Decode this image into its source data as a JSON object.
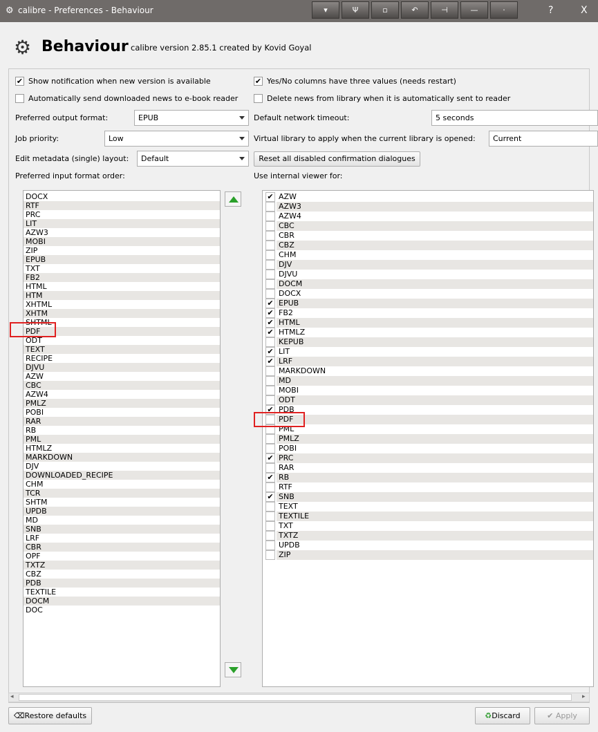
{
  "window": {
    "title": "calibre - Preferences - Behaviour",
    "help": "?",
    "close": "X"
  },
  "header": {
    "title": "Behaviour",
    "subtitle": "calibre version 2.85.1 created by Kovid Goyal"
  },
  "options": {
    "show_notification": {
      "label": "Show notification when new version is available",
      "checked": true
    },
    "yes_no": {
      "label": "Yes/No columns have three values (needs restart)",
      "checked": true
    },
    "auto_send_news": {
      "label": "Automatically send downloaded news to e-book reader",
      "checked": false
    },
    "delete_news": {
      "label": "Delete news from library when it is automatically sent to reader",
      "checked": false
    },
    "output_format": {
      "label": "Preferred output format:",
      "value": "EPUB"
    },
    "network_timeout": {
      "label": "Default network timeout:",
      "value": "5 seconds"
    },
    "job_priority": {
      "label": "Job priority:",
      "value": "Low"
    },
    "virtual_library": {
      "label": "Virtual library to apply when the current library is opened:",
      "value": "Current"
    },
    "edit_metadata_layout": {
      "label": "Edit metadata (single) layout:",
      "value": "Default"
    },
    "reset_dialogs": "Reset all disabled confirmation dialogues",
    "input_order_label": "Preferred input format order:",
    "viewer_label": "Use internal viewer for:"
  },
  "input_formats": [
    "DOCX",
    "RTF",
    "PRC",
    "LIT",
    "AZW3",
    "MOBI",
    "ZIP",
    "EPUB",
    "TXT",
    "FB2",
    "HTML",
    "HTM",
    "XHTML",
    "XHTM",
    "SHTML",
    "PDF",
    "ODT",
    "TEXT",
    "RECIPE",
    "DJVU",
    "AZW",
    "CBC",
    "AZW4",
    "PMLZ",
    "POBI",
    "RAR",
    "RB",
    "PML",
    "HTMLZ",
    "MARKDOWN",
    "DJV",
    "DOWNLOADED_RECIPE",
    "CHM",
    "TCR",
    "SHTM",
    "UPDB",
    "MD",
    "SNB",
    "LRF",
    "CBR",
    "OPF",
    "TXTZ",
    "CBZ",
    "PDB",
    "TEXTILE",
    "DOCM",
    "DOC"
  ],
  "viewer_formats": [
    {
      "name": "AZW",
      "checked": true
    },
    {
      "name": "AZW3",
      "checked": false
    },
    {
      "name": "AZW4",
      "checked": false
    },
    {
      "name": "CBC",
      "checked": false
    },
    {
      "name": "CBR",
      "checked": false
    },
    {
      "name": "CBZ",
      "checked": false
    },
    {
      "name": "CHM",
      "checked": false
    },
    {
      "name": "DJV",
      "checked": false
    },
    {
      "name": "DJVU",
      "checked": false
    },
    {
      "name": "DOCM",
      "checked": false
    },
    {
      "name": "DOCX",
      "checked": false
    },
    {
      "name": "EPUB",
      "checked": true
    },
    {
      "name": "FB2",
      "checked": true
    },
    {
      "name": "HTML",
      "checked": true
    },
    {
      "name": "HTMLZ",
      "checked": true
    },
    {
      "name": "KEPUB",
      "checked": false
    },
    {
      "name": "LIT",
      "checked": true
    },
    {
      "name": "LRF",
      "checked": true
    },
    {
      "name": "MARKDOWN",
      "checked": false
    },
    {
      "name": "MD",
      "checked": false
    },
    {
      "name": "MOBI",
      "checked": false
    },
    {
      "name": "ODT",
      "checked": false
    },
    {
      "name": "PDB",
      "checked": true
    },
    {
      "name": "PDF",
      "checked": false
    },
    {
      "name": "PML",
      "checked": false
    },
    {
      "name": "PMLZ",
      "checked": false
    },
    {
      "name": "POBI",
      "checked": false
    },
    {
      "name": "PRC",
      "checked": true
    },
    {
      "name": "RAR",
      "checked": false
    },
    {
      "name": "RB",
      "checked": true
    },
    {
      "name": "RTF",
      "checked": false
    },
    {
      "name": "SNB",
      "checked": true
    },
    {
      "name": "TEXT",
      "checked": false
    },
    {
      "name": "TEXTILE",
      "checked": false
    },
    {
      "name": "TXT",
      "checked": false
    },
    {
      "name": "TXTZ",
      "checked": false
    },
    {
      "name": "UPDB",
      "checked": false
    },
    {
      "name": "ZIP",
      "checked": false
    }
  ],
  "footer": {
    "restore": "Restore defaults",
    "discard": "Discard",
    "apply": "Apply"
  },
  "colors": {
    "titlebar": "#6f6b69",
    "highlight": "#e02020",
    "arrow": "#2aa02a"
  }
}
